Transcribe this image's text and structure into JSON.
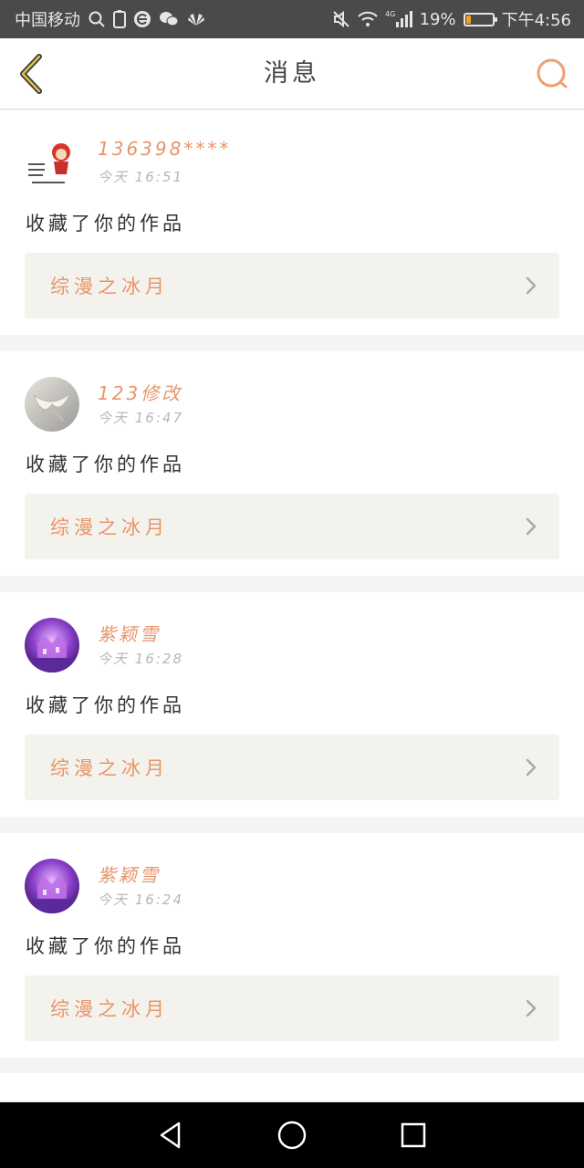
{
  "status_bar": {
    "carrier": "中国移动",
    "battery_percent": "19%",
    "battery_level": 0.19,
    "time": "下午4:56",
    "network": "4G",
    "icons": [
      "search-icon",
      "sim-icon",
      "browser-icon",
      "wechat-icon",
      "huawei-icon",
      "mute-icon",
      "wifi-icon",
      "signal-icon",
      "battery-icon"
    ]
  },
  "header": {
    "title": "消息",
    "back_icon": "chevron-left-icon",
    "search_icon": "search-icon",
    "accent_color": "#e8956b"
  },
  "messages": [
    {
      "username": "136398****",
      "time": "今天 16:51",
      "action": "收藏了你的作品",
      "work_title": "综漫之冰月",
      "avatar": "cartoon-avatar"
    },
    {
      "username": "123修改",
      "time": "今天 16:47",
      "action": "收藏了你的作品",
      "work_title": "综漫之冰月",
      "avatar": "ribbon-avatar"
    },
    {
      "username": "紫颖雪",
      "time": "今天 16:28",
      "action": "收藏了你的作品",
      "work_title": "综漫之冰月",
      "avatar": "castle-avatar"
    },
    {
      "username": "紫颖雪",
      "time": "今天 16:24",
      "action": "收藏了你的作品",
      "work_title": "综漫之冰月",
      "avatar": "castle-avatar"
    }
  ],
  "system_nav": {
    "icons": [
      "back-triangle-icon",
      "home-circle-icon",
      "recents-square-icon"
    ]
  }
}
